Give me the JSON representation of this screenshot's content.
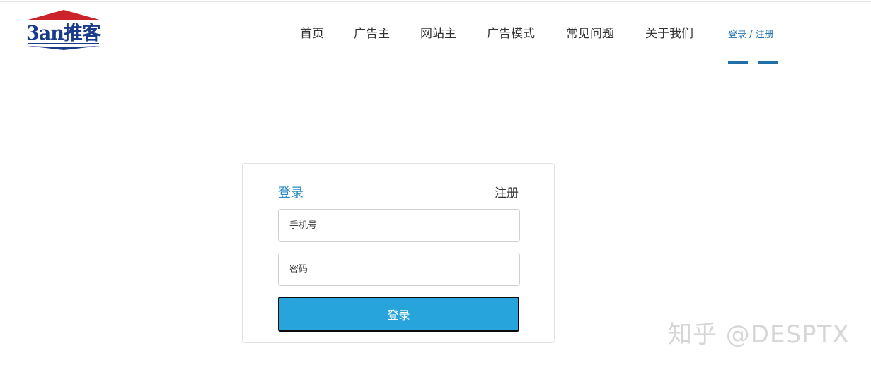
{
  "header": {
    "logo_text": "3an推客",
    "nav": [
      {
        "label": "首页"
      },
      {
        "label": "广告主"
      },
      {
        "label": "网站主"
      },
      {
        "label": "广告模式"
      },
      {
        "label": "常见问题"
      },
      {
        "label": "关于我们"
      }
    ],
    "auth": {
      "login": "登录",
      "separator": " / ",
      "register": "注册"
    }
  },
  "form": {
    "tab_login": "登录",
    "tab_register": "注册",
    "phone_placeholder": "手机号",
    "password_placeholder": "密码",
    "submit_label": "登录"
  },
  "watermark": "知乎 @DESPTX",
  "colors": {
    "accent": "#1f6fa8",
    "button": "#28a4dc",
    "logo_red": "#cc2229",
    "logo_blue": "#1a3a8c"
  }
}
